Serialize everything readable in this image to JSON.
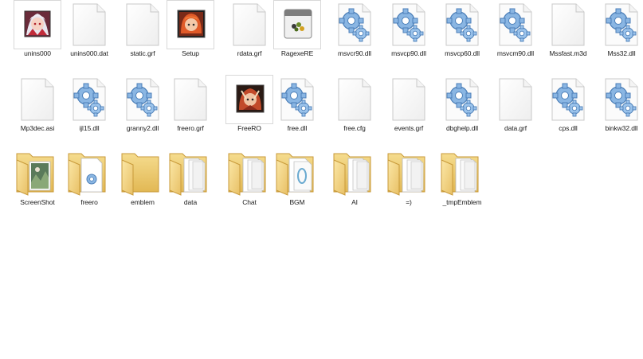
{
  "rows": [
    [
      {
        "label": "unins000",
        "icon": "anime-girl-app-icon"
      },
      {
        "label": "unins000.dat",
        "icon": "blank-file-icon"
      },
      {
        "label": "static.grf",
        "icon": "blank-file-icon"
      },
      {
        "label": "Setup",
        "icon": "redhead-character-app-icon"
      },
      {
        "label": "rdata.grf",
        "icon": "blank-file-icon"
      },
      {
        "label": "RagexeRE",
        "icon": "window-app-icon"
      },
      {
        "label": "msvcr90.dll",
        "icon": "dll-gear-icon"
      },
      {
        "label": "msvcp90.dll",
        "icon": "dll-gear-icon"
      },
      {
        "label": "msvcp60.dll",
        "icon": "dll-gear-icon"
      },
      {
        "label": "msvcm90.dll",
        "icon": "dll-gear-icon"
      },
      {
        "label": "Mssfast.m3d",
        "icon": "blank-file-icon"
      },
      {
        "label": "Mss32.dll",
        "icon": "dll-gear-icon"
      }
    ],
    [
      {
        "label": "Mp3dec.asi",
        "icon": "blank-file-icon"
      },
      {
        "label": "ijl15.dll",
        "icon": "dll-gear-icon"
      },
      {
        "label": "granny2.dll",
        "icon": "dll-gear-icon"
      },
      {
        "label": "freero.grf",
        "icon": "blank-file-icon"
      },
      {
        "label": "FreeRO",
        "icon": "freero-character-app-icon"
      },
      {
        "label": "free.dll",
        "icon": "dll-gear-icon"
      },
      {
        "label": "free.cfg",
        "icon": "blank-file-icon"
      },
      {
        "label": "events.grf",
        "icon": "blank-file-icon"
      },
      {
        "label": "dbghelp.dll",
        "icon": "dll-gear-icon"
      },
      {
        "label": "data.grf",
        "icon": "blank-file-icon"
      },
      {
        "label": "cps.dll",
        "icon": "dll-gear-icon"
      },
      {
        "label": "binkw32.dll",
        "icon": "dll-gear-icon"
      }
    ],
    [
      {
        "label": "ScreenShot",
        "icon": "folder-image-icon"
      },
      {
        "label": "freero",
        "icon": "folder-dll-icon"
      },
      {
        "label": "emblem",
        "icon": "folder-empty-icon"
      },
      {
        "label": "data",
        "icon": "folder-files-icon"
      },
      {
        "label": "Chat",
        "icon": "folder-files-icon"
      },
      {
        "label": "BGM",
        "icon": "folder-media-icon"
      },
      {
        "label": "AI",
        "icon": "folder-files-icon"
      },
      {
        "label": "=)",
        "icon": "folder-files-icon"
      },
      {
        "label": "_tmpEmblem",
        "icon": "folder-files-icon"
      }
    ]
  ]
}
